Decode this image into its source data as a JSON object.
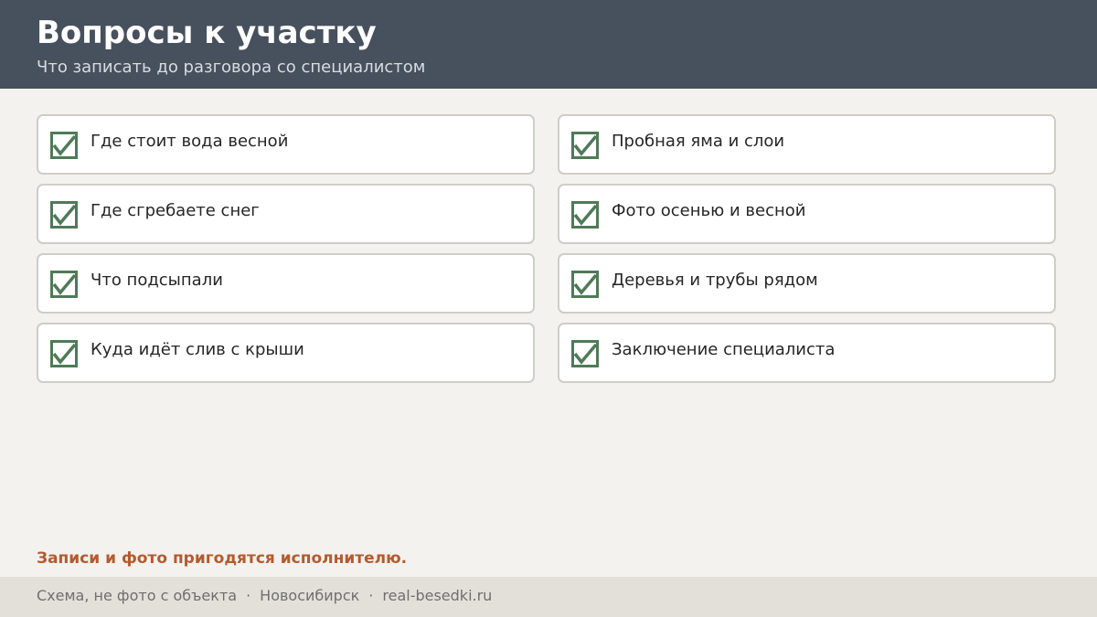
{
  "header": {
    "title": "Вопросы к участку",
    "subtitle": "Что записать до разговора со специалистом"
  },
  "checklist": {
    "left": [
      {
        "label": "Где стоит вода весной",
        "checked": true
      },
      {
        "label": "Где сгребаете снег",
        "checked": true
      },
      {
        "label": "Что подсыпали",
        "checked": true
      },
      {
        "label": "Куда идёт слив с крыши",
        "checked": true
      }
    ],
    "right": [
      {
        "label": "Пробная яма и слои",
        "checked": true
      },
      {
        "label": "Фото осенью и весной",
        "checked": true
      },
      {
        "label": "Деревья и трубы рядом",
        "checked": true
      },
      {
        "label": "Заключение специалиста",
        "checked": true
      }
    ],
    "check_icon": "checkbox-checked-icon",
    "check_color": "#4f7a57"
  },
  "note": "Записи и фото пригодятся исполнителю.",
  "footer": {
    "caption": "Схема, не фото с объекта",
    "separator": "·",
    "city": "Новосибирск",
    "site": "real-besedki.ru"
  },
  "colors": {
    "header_bg": "#47505d",
    "page_bg": "#f3f2ee",
    "accent": "#b55a2f",
    "footer_bg": "#e3e0da"
  }
}
